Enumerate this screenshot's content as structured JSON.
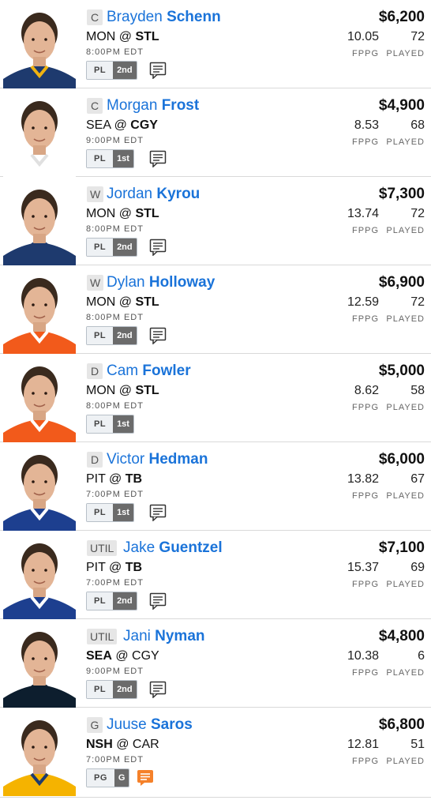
{
  "colors": {
    "name": "#1a73d9",
    "news_active": "#f5812a",
    "news_default": "#333333"
  },
  "labels": {
    "fppg": "FPPG",
    "played": "PLAYED"
  },
  "players": [
    {
      "pos": "C",
      "first": "Brayden",
      "last": "Schenn",
      "away": "MON",
      "home": "STL",
      "bold_team": "home",
      "time": "8:00PM EDT",
      "pl": "PL",
      "line": "2nd",
      "news": true,
      "news_color": "default",
      "salary": "$6,200",
      "fppg": "10.05",
      "played": "72",
      "jersey": "#1e3a6e",
      "trim": "#f1b310"
    },
    {
      "pos": "C",
      "first": "Morgan",
      "last": "Frost",
      "away": "SEA",
      "home": "CGY",
      "bold_team": "home",
      "time": "9:00PM EDT",
      "pl": "PL",
      "line": "1st",
      "news": true,
      "news_color": "default",
      "salary": "$4,900",
      "fppg": "8.53",
      "played": "68",
      "jersey": "#ffffff",
      "trim": "#e0e0e0"
    },
    {
      "pos": "W",
      "first": "Jordan",
      "last": "Kyrou",
      "away": "MON",
      "home": "STL",
      "bold_team": "home",
      "time": "8:00PM EDT",
      "pl": "PL",
      "line": "2nd",
      "news": true,
      "news_color": "default",
      "salary": "$7,300",
      "fppg": "13.74",
      "played": "72",
      "jersey": "#1e3a6e",
      "trim": "#1e3a6e"
    },
    {
      "pos": "W",
      "first": "Dylan",
      "last": "Holloway",
      "away": "MON",
      "home": "STL",
      "bold_team": "home",
      "time": "8:00PM EDT",
      "pl": "PL",
      "line": "2nd",
      "news": true,
      "news_color": "default",
      "salary": "$6,900",
      "fppg": "12.59",
      "played": "72",
      "jersey": "#f25a1b",
      "trim": "#ffffff"
    },
    {
      "pos": "D",
      "first": "Cam",
      "last": "Fowler",
      "away": "MON",
      "home": "STL",
      "bold_team": "home",
      "time": "8:00PM EDT",
      "pl": "PL",
      "line": "1st",
      "news": false,
      "news_color": "default",
      "salary": "$5,000",
      "fppg": "8.62",
      "played": "58",
      "jersey": "#f25a1b",
      "trim": "#ffffff"
    },
    {
      "pos": "D",
      "first": "Victor",
      "last": "Hedman",
      "away": "PIT",
      "home": "TB",
      "bold_team": "home",
      "time": "7:00PM EDT",
      "pl": "PL",
      "line": "1st",
      "news": true,
      "news_color": "default",
      "salary": "$6,000",
      "fppg": "13.82",
      "played": "67",
      "jersey": "#1d3f8f",
      "trim": "#ffffff"
    },
    {
      "pos": "UTIL",
      "first": "Jake",
      "last": "Guentzel",
      "away": "PIT",
      "home": "TB",
      "bold_team": "home",
      "time": "7:00PM EDT",
      "pl": "PL",
      "line": "2nd",
      "news": true,
      "news_color": "default",
      "salary": "$7,100",
      "fppg": "15.37",
      "played": "69",
      "jersey": "#1d3f8f",
      "trim": "#ffffff"
    },
    {
      "pos": "UTIL",
      "first": "Jani",
      "last": "Nyman",
      "away": "SEA",
      "home": "CGY",
      "bold_team": "away",
      "time": "9:00PM EDT",
      "pl": "PL",
      "line": "2nd",
      "news": true,
      "news_color": "default",
      "salary": "$4,800",
      "fppg": "10.38",
      "played": "6",
      "jersey": "#0d1e2e",
      "trim": "#0d1e2e"
    },
    {
      "pos": "G",
      "first": "Juuse",
      "last": "Saros",
      "away": "NSH",
      "home": "CAR",
      "bold_team": "away",
      "time": "7:00PM EDT",
      "pl": "PG",
      "line": "G",
      "news": true,
      "news_color": "active",
      "salary": "$6,800",
      "fppg": "12.81",
      "played": "51",
      "jersey": "#f5b300",
      "trim": "#1e3a6e"
    }
  ]
}
